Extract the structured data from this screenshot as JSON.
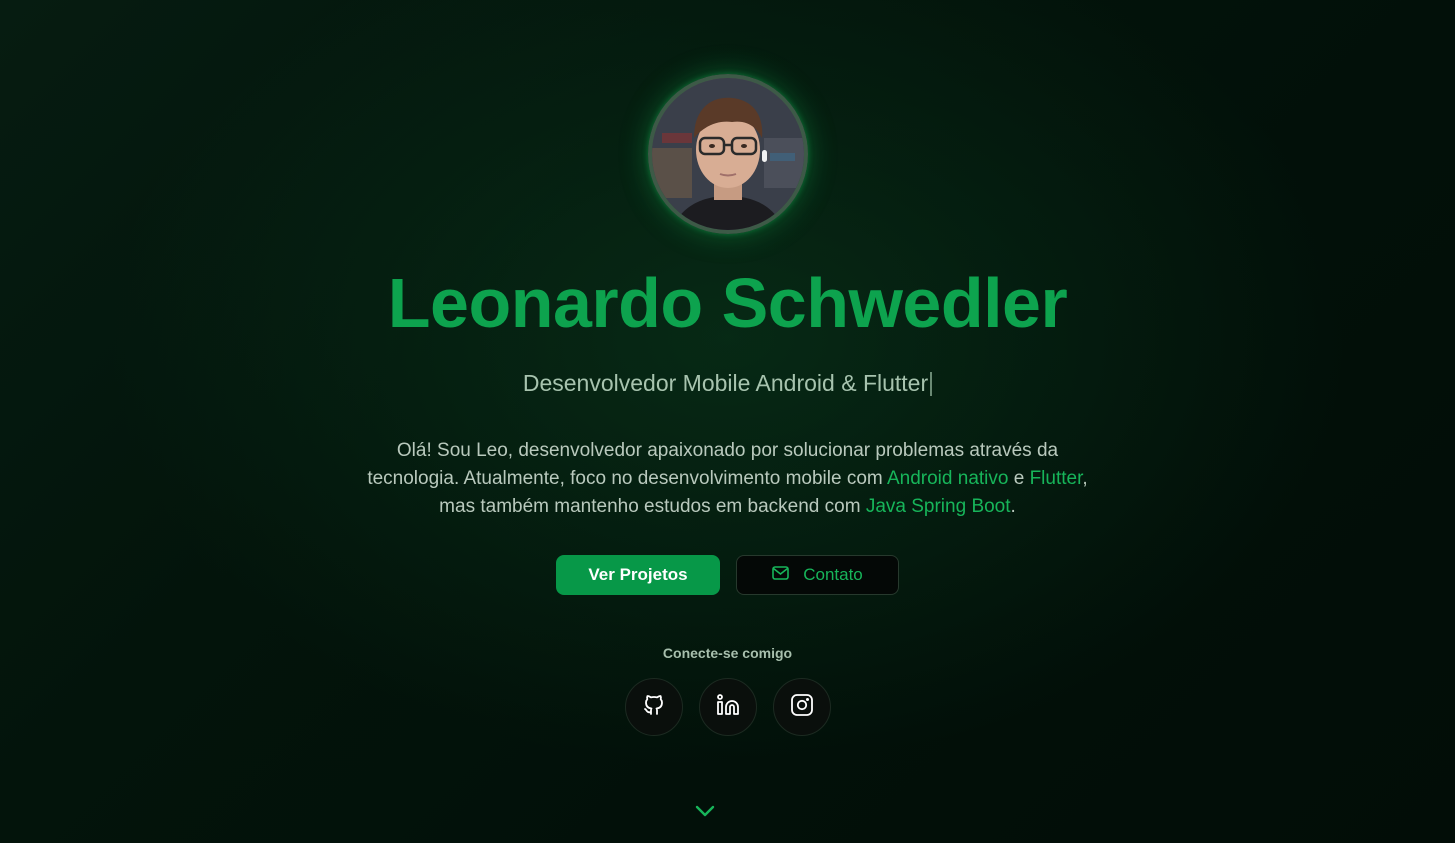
{
  "profile": {
    "name": "Leonardo Schwedler",
    "subtitle": "Desenvolvedor Mobile Android & Flutter",
    "bio": {
      "line1": "Olá! Sou Leo, desenvolvedor apaixonado por solucionar problemas através da",
      "line2_pre": "tecnologia. Atualmente, foco no desenvolvimento mobile com ",
      "hl_android": "Android nativo",
      "conj": " e ",
      "hl_flutter": "Flutter",
      "comma": ",",
      "line3_pre": "mas também mantenho estudos em backend com ",
      "hl_spring": "Java Spring Boot",
      "period": "."
    }
  },
  "actions": {
    "projects_label": "Ver Projetos",
    "contact_label": "Contato"
  },
  "connect": {
    "label": "Conecte-se comigo",
    "icons": [
      "github-icon",
      "linkedin-icon",
      "instagram-icon"
    ]
  },
  "colors": {
    "accent": "#0da34e",
    "highlight": "#17b55a",
    "primary_button": "#079848",
    "background": "#03140b"
  }
}
